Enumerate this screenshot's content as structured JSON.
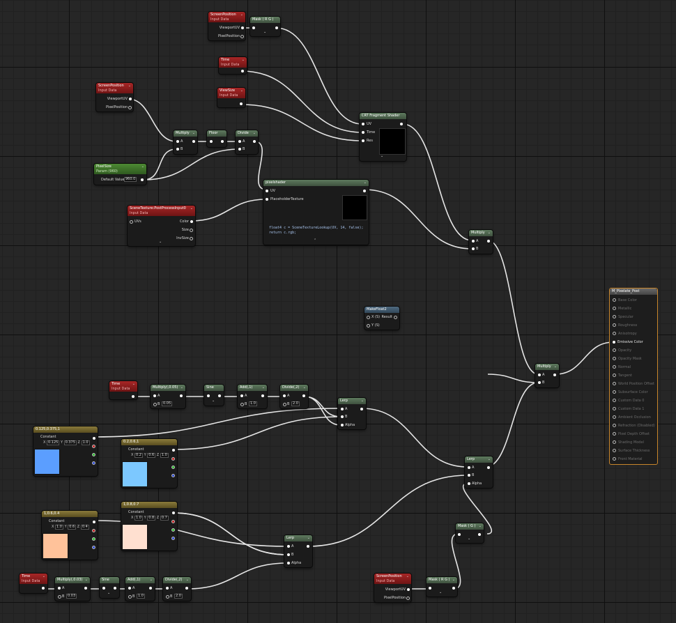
{
  "nodes": {
    "screenpos_top": {
      "title": "ScreenPosition",
      "subtitle": "Input Data",
      "out1": "ViewportUV",
      "out2": "PixelPosition"
    },
    "mask_rg_top": {
      "title": "Mask ( R G )"
    },
    "time_top": {
      "title": "Time",
      "subtitle": "Input Data"
    },
    "viewsize": {
      "title": "ViewSize",
      "subtitle": "Input Data"
    },
    "screenpos_left": {
      "title": "ScreenPosition",
      "subtitle": "Input Data",
      "out1": "ViewportUV",
      "out2": "PixelPosition"
    },
    "multiply_1": {
      "title": "Multiply",
      "in_a": "A",
      "in_b": "B"
    },
    "floor": {
      "title": "Floor"
    },
    "divide_1": {
      "title": "Divide",
      "in_a": "A",
      "in_b": "B"
    },
    "crt": {
      "title": "CRT Fragment Shader",
      "in1": "UV",
      "in2": "Time",
      "in3": "Res"
    },
    "pixelsize": {
      "title": "PixelSize",
      "subtitle": "Param (960)",
      "default_label": "Default Value",
      "default_value": "960.0"
    },
    "scenetexture": {
      "title": "SceneTexture:PostProcessInput0",
      "subtitle": "Input Data",
      "in1": "UVs",
      "out1": "Color",
      "out2": "Size",
      "out3": "InvSize"
    },
    "pixelshader": {
      "title": "pixelshader",
      "in1": "UV",
      "in2": "PlaceholderTexture",
      "code_line1": "float4 c = SceneTextureLookup(UV, 14, false);",
      "code_line2": "return c.rgb;"
    },
    "multiply_2": {
      "title": "Multiply",
      "in_a": "A",
      "in_b": "B"
    },
    "makefloat2": {
      "title": "MakeFloat2",
      "in1": "X (S)",
      "in2": "Y (S)",
      "out1": "Result"
    },
    "multiply_final": {
      "title": "Multiply",
      "in_a": "A",
      "in_b": "B"
    },
    "material": {
      "title": "M_Pixelate_Post",
      "pins": [
        "Base Color",
        "Metallic",
        "Specular",
        "Roughness",
        "Anisotropy",
        "Emissive Color",
        "Opacity",
        "Opacity Mask",
        "Normal",
        "Tangent",
        "World Position Offset",
        "Subsurface Color",
        "Custom Data 0",
        "Custom Data 1",
        "Ambient Occlusion",
        "Refraction (Disabled)",
        "Pixel Depth Offset",
        "Shading Model",
        "Surface Thickness",
        "Front Material"
      ],
      "active_pin": "Emissive Color"
    },
    "time_mid": {
      "title": "Time",
      "subtitle": "Input Data"
    },
    "multiply_005": {
      "title": "Multiply(,0.05)",
      "in_a": "A",
      "in_b": "B",
      "b_value": "0.05"
    },
    "sine_1": {
      "title": "Sine"
    },
    "add_1": {
      "title": "Add(,1)",
      "in_a": "A",
      "in_b": "B",
      "b_value": "1.0"
    },
    "divide_2": {
      "title": "Divide(,2)",
      "in_a": "A",
      "in_b": "B",
      "b_value": "2.0"
    },
    "lerp_1": {
      "title": "Lerp",
      "in_a": "A",
      "in_b": "B",
      "in_alpha": "Alpha"
    },
    "const_blue": {
      "title": "0.125,0.375,1",
      "label": "Constant",
      "x": "0.125",
      "y": "0.375",
      "z": "1.0",
      "color": "#5b9eff"
    },
    "const_lightblue": {
      "title": "0.2,0.6,1",
      "label": "Constant",
      "x": "0.2",
      "y": "0.6",
      "z": "1.0",
      "color": "#7cc8ff"
    },
    "lerp_2": {
      "title": "Lerp",
      "in_a": "A",
      "in_b": "B",
      "in_alpha": "Alpha"
    },
    "const_peach": {
      "title": "1,0.6,0.4",
      "label": "Constant",
      "x": "1.0",
      "y": "0.6",
      "z": "0.4",
      "color": "#ffc29a"
    },
    "const_cream": {
      "title": "1,0.8,0.7",
      "label": "Constant",
      "x": "1.0",
      "y": "0.8",
      "z": "0.7",
      "color": "#ffe0d0"
    },
    "lerp_3": {
      "title": "Lerp",
      "in_a": "A",
      "in_b": "B",
      "in_alpha": "Alpha"
    },
    "mask_g": {
      "title": "Mask ( G )"
    },
    "time_bottom": {
      "title": "Time",
      "subtitle": "Input Data"
    },
    "multiply_003": {
      "title": "Multiply(,0.03)",
      "in_a": "A",
      "in_b": "B",
      "b_value": "0.03"
    },
    "sine_2": {
      "title": "Sine"
    },
    "add_2": {
      "title": "Add(,1)",
      "in_a": "A",
      "in_b": "B",
      "b_value": "1.0"
    },
    "divide_3": {
      "title": "Divide(,2)",
      "in_a": "A",
      "in_b": "B",
      "b_value": "2.0"
    },
    "screenpos_bottom": {
      "title": "ScreenPosition",
      "subtitle": "Input Data",
      "out1": "ViewportUV",
      "out2": "PixelPosition"
    },
    "mask_rg_bottom": {
      "title": "Mask ( R G )"
    }
  },
  "labels": {
    "x": "X",
    "y": "Y",
    "z": "Z"
  },
  "colors": {
    "input_header": "#a82626",
    "function_header": "#5e7a5e",
    "param_header": "#4d8a33",
    "constant_header": "#8a7a3a",
    "material_border": "#c8852a",
    "wire": "#e6e6e6"
  }
}
